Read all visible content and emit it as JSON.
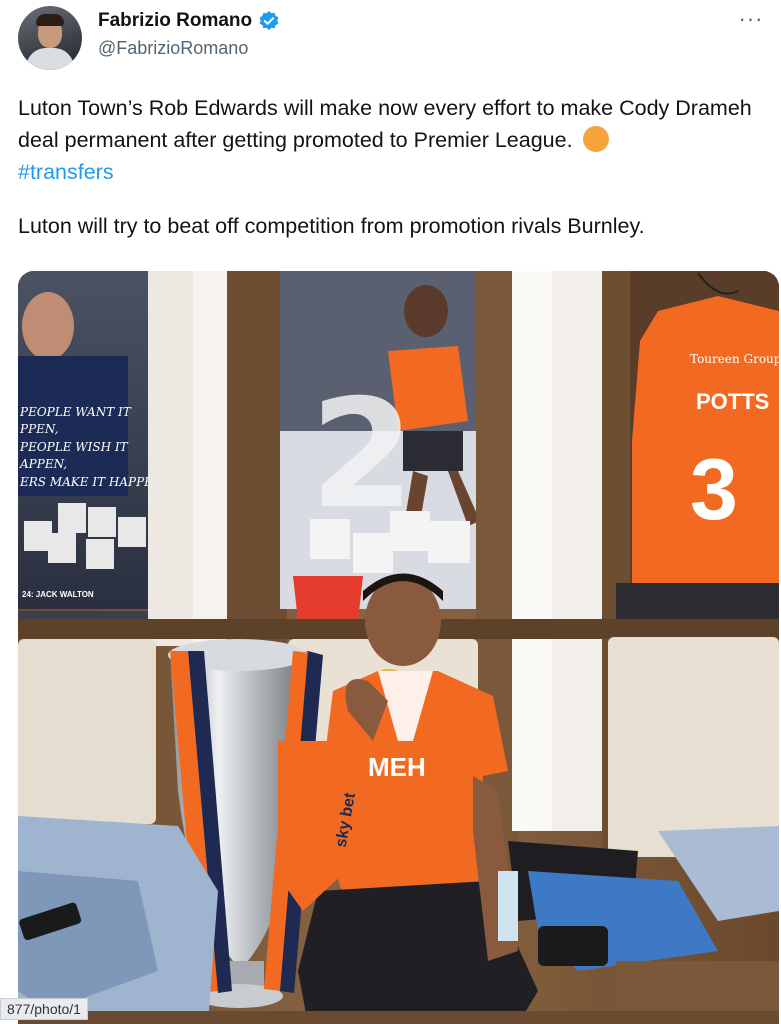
{
  "author": {
    "display_name": "Fabrizio Romano",
    "handle": "@FabrizioRomano",
    "verified": true
  },
  "tweet": {
    "paragraph1_main": "Luton Town’s Rob Edwards will make now every effort to make Cody Drameh deal permanent after getting promoted to Premier League.",
    "hashtag": "#transfers",
    "paragraph2": "Luton will try to beat off competition from promotion rivals Burnley."
  },
  "photo": {
    "poster_left_text": [
      "PEOPLE WANT IT",
      "PPEN,",
      "PEOPLE WISH IT",
      "APPEN,",
      "ERS MAKE IT HAPPEN."
    ],
    "poster_left_caption": "24: JACK WALTON",
    "poster_center_number": "2",
    "shirt_sponsor": "Toureen Group",
    "shirt_name": "POTTS",
    "shirt_number": "3",
    "ribbon_text": "sky bet",
    "player_shirt_text": "MEH"
  },
  "status_url": "877/photo/1",
  "icons": {
    "verified": "verified-badge-icon",
    "more": "more-options-icon"
  },
  "colors": {
    "link": "#1d9bf0",
    "secondary_text": "#536471",
    "verified": "#1d9bf0",
    "luton_orange": "#f26a21",
    "emoji_orange": "#f4a43a"
  }
}
